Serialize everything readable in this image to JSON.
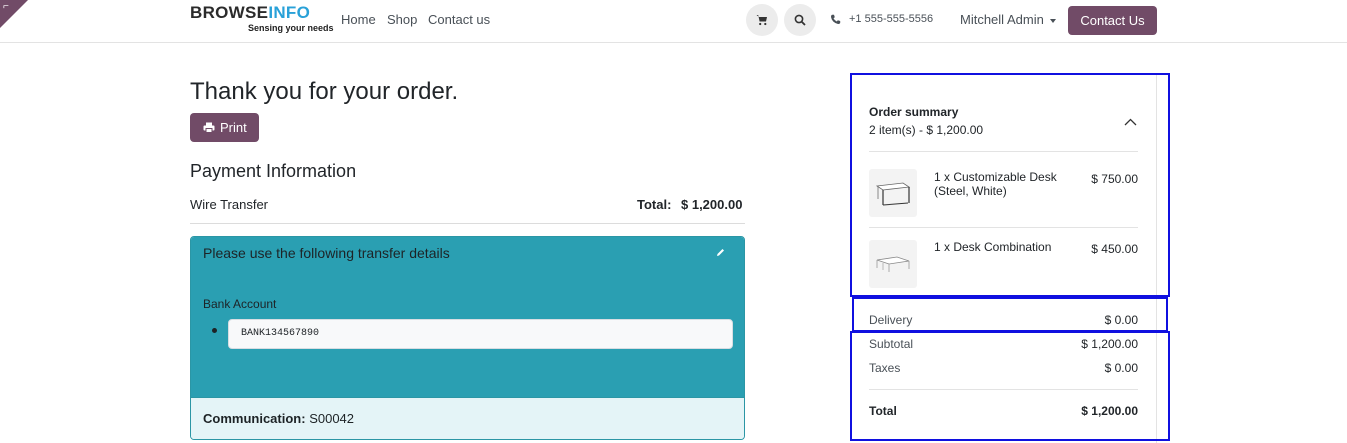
{
  "corner": {
    "mark": "⌐"
  },
  "header": {
    "logo": {
      "part1": "BROWSE",
      "part2": "INFO",
      "tagline": "Sensing your needs"
    },
    "nav": [
      {
        "label": "Home"
      },
      {
        "label": "Shop"
      },
      {
        "label": "Contact us"
      }
    ],
    "cart_icon": "cart-icon",
    "search_icon": "search-icon",
    "phone": "+1 555-555-5556",
    "user": "Mitchell Admin",
    "contact_button": "Contact Us"
  },
  "main": {
    "title": "Thank you for your order.",
    "print_label": "Print",
    "payment_heading": "Payment Information",
    "payment_method": "Wire Transfer",
    "total_label": "Total:",
    "total_value": "$ 1,200.00",
    "transfer": {
      "title": "Please use the following transfer details",
      "bank_label": "Bank Account",
      "bank_value": "BANK134567890",
      "communication_label": "Communication:",
      "communication_value": "S00042"
    }
  },
  "summary": {
    "title": "Order summary",
    "subtitle": "2 item(s) -  $ 1,200.00",
    "items": [
      {
        "name": "1 x Customizable Desk (Steel, White)",
        "price": "$ 750.00"
      },
      {
        "name": "1 x Desk Combination",
        "price": "$ 450.00"
      }
    ],
    "delivery_label": "Delivery",
    "delivery_value": "$ 0.00",
    "subtotal_label": "Subtotal",
    "subtotal_value": "$ 1,200.00",
    "taxes_label": "Taxes",
    "taxes_value": "$ 0.00",
    "total_label": "Total",
    "total_value": "$ 1,200.00"
  },
  "colors": {
    "brand": "#714b67",
    "info": "#2a9fb2",
    "highlight": "#1010e0"
  }
}
